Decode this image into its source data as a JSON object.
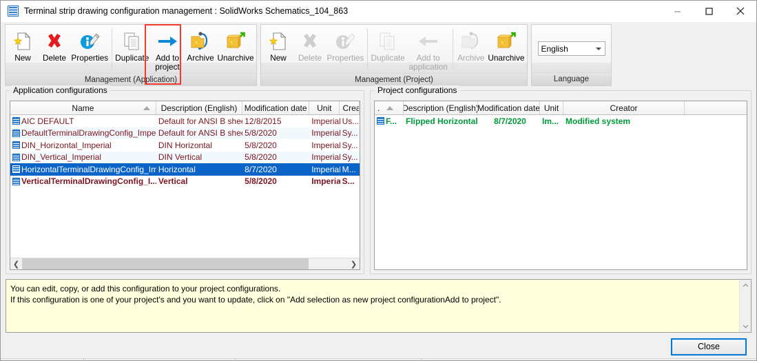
{
  "window": {
    "title": "Terminal strip drawing configuration management : SolidWorks Schematics_104_863",
    "icon": "config-grid-icon",
    "minimize_label": "Minimize",
    "maximize_label": "Maximize",
    "close_label": "Close"
  },
  "ribbon": {
    "groups": [
      {
        "caption": "Management (Application)",
        "buttons": [
          {
            "label": "New",
            "icon": "new-document-icon",
            "enabled": true
          },
          {
            "label": "Delete",
            "icon": "red-x-icon",
            "enabled": true
          },
          {
            "label": "Properties",
            "icon": "info-pencil-icon",
            "enabled": true
          },
          {
            "label": "Duplicate",
            "icon": "copy-pages-icon",
            "enabled": true
          },
          {
            "label": "Add to project",
            "icon": "arrow-right-icon",
            "enabled": true,
            "highlighted": true
          },
          {
            "label": "Archive",
            "icon": "archive-folder-icon",
            "enabled": true
          },
          {
            "label": "Unarchive",
            "icon": "unarchive-box-icon",
            "enabled": true
          }
        ]
      },
      {
        "caption": "Management (Project)",
        "buttons": [
          {
            "label": "New",
            "icon": "new-document-icon",
            "enabled": true
          },
          {
            "label": "Delete",
            "icon": "red-x-icon",
            "enabled": false
          },
          {
            "label": "Properties",
            "icon": "info-pencil-icon",
            "enabled": false
          },
          {
            "label": "Duplicate",
            "icon": "copy-pages-icon",
            "enabled": false
          },
          {
            "label": "Add to application",
            "icon": "arrow-left-icon",
            "enabled": false
          },
          {
            "label": "Archive",
            "icon": "archive-folder-icon",
            "enabled": false
          },
          {
            "label": "Unarchive",
            "icon": "unarchive-box-icon",
            "enabled": true
          }
        ]
      },
      {
        "caption": "Language",
        "combo": {
          "value": "English",
          "icon": "chevron-down-icon"
        }
      }
    ]
  },
  "application_panel": {
    "legend": "Application configurations",
    "columns": [
      "Name",
      "Description (English)",
      "Modification date",
      "Unit",
      "Creator"
    ],
    "sorted_column": "Name",
    "sort_direction": "ascending",
    "rows": [
      {
        "name": "AIC DEFAULT",
        "description": "Default for ANSI B sheet",
        "date": "12/8/2015",
        "unit": "Imperial",
        "creator": "Us...",
        "state": "normal"
      },
      {
        "name": "DefaultTerminalDrawingConfig_Imperial",
        "description": "Default for ANSI B sheet",
        "date": "5/8/2020",
        "unit": "Imperial",
        "creator": "Sy...",
        "state": "alt"
      },
      {
        "name": "DIN_Horizontal_Imperial",
        "description": "DIN Horizontal",
        "date": "5/8/2020",
        "unit": "Imperial",
        "creator": "Sy...",
        "state": "normal"
      },
      {
        "name": "DIN_Vertical_Imperial",
        "description": "DIN Vertical",
        "date": "5/8/2020",
        "unit": "Imperial",
        "creator": "Sy...",
        "state": "alt"
      },
      {
        "name": "HorizontalTerminalDrawingConfig_Impe...",
        "description": "Horizontal",
        "date": "8/7/2020",
        "unit": "Imperial",
        "creator": "M...",
        "state": "selected"
      },
      {
        "name": "VerticalTerminalDrawingConfig_I...",
        "description": "Vertical",
        "date": "5/8/2020",
        "unit": "Imperial",
        "creator": "S...",
        "state": "modified"
      }
    ],
    "scrollbar": {
      "left_arrow": "❮",
      "right_arrow": "❯"
    }
  },
  "project_panel": {
    "legend": "Project configurations",
    "columns": [
      ".",
      "Description (English)",
      "Modification date",
      "Unit",
      "Creator",
      ""
    ],
    "sort_direction": "ascending",
    "rows": [
      {
        "name": "F...",
        "description": "Flipped Horizontal",
        "date": "8/7/2020",
        "unit": "Im...",
        "creator": "Modified system",
        "state": "green"
      }
    ]
  },
  "info_panel": {
    "line1": "You can edit, copy, or add this configuration to your project configurations.",
    "line2": "If this configuration is one of your project's and you want to update, click on \"Add selection as new project configurationAdd to project\".",
    "scroll_up_icon": "chevron-up-icon",
    "scroll_down_icon": "chevron-down-icon"
  },
  "footer": {
    "close_label": "Close"
  },
  "colors": {
    "selection_blue": "#0a64c8",
    "row_text_red": "#7b1520",
    "green_row": "#009b3a",
    "annotation_red": "#ef3b2d",
    "focus_blue": "#0078d7",
    "info_background": "#ffffdd"
  }
}
